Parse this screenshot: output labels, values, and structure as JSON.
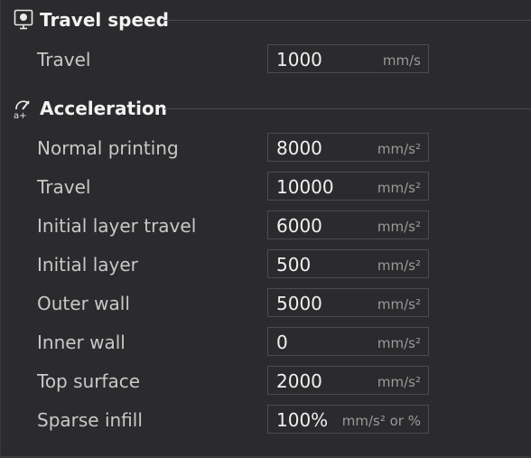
{
  "travel_speed": {
    "title": "Travel speed",
    "icon": "speed-gauge-icon",
    "rows": [
      {
        "label": "Travel",
        "value": "1000",
        "unit": "mm/s"
      }
    ]
  },
  "acceleration": {
    "title": "Acceleration",
    "icon": "acceleration-icon",
    "rows": [
      {
        "label": "Normal printing",
        "value": "8000",
        "unit": "mm/s²"
      },
      {
        "label": "Travel",
        "value": "10000",
        "unit": "mm/s²"
      },
      {
        "label": "Initial layer travel",
        "value": "6000",
        "unit": "mm/s²"
      },
      {
        "label": "Initial layer",
        "value": "500",
        "unit": "mm/s²"
      },
      {
        "label": "Outer wall",
        "value": "5000",
        "unit": "mm/s²"
      },
      {
        "label": "Inner wall",
        "value": "0",
        "unit": "mm/s²"
      },
      {
        "label": "Top surface",
        "value": "2000",
        "unit": "mm/s²"
      },
      {
        "label": "Sparse infill",
        "value": "100%",
        "unit": "mm/s² or %"
      }
    ]
  }
}
